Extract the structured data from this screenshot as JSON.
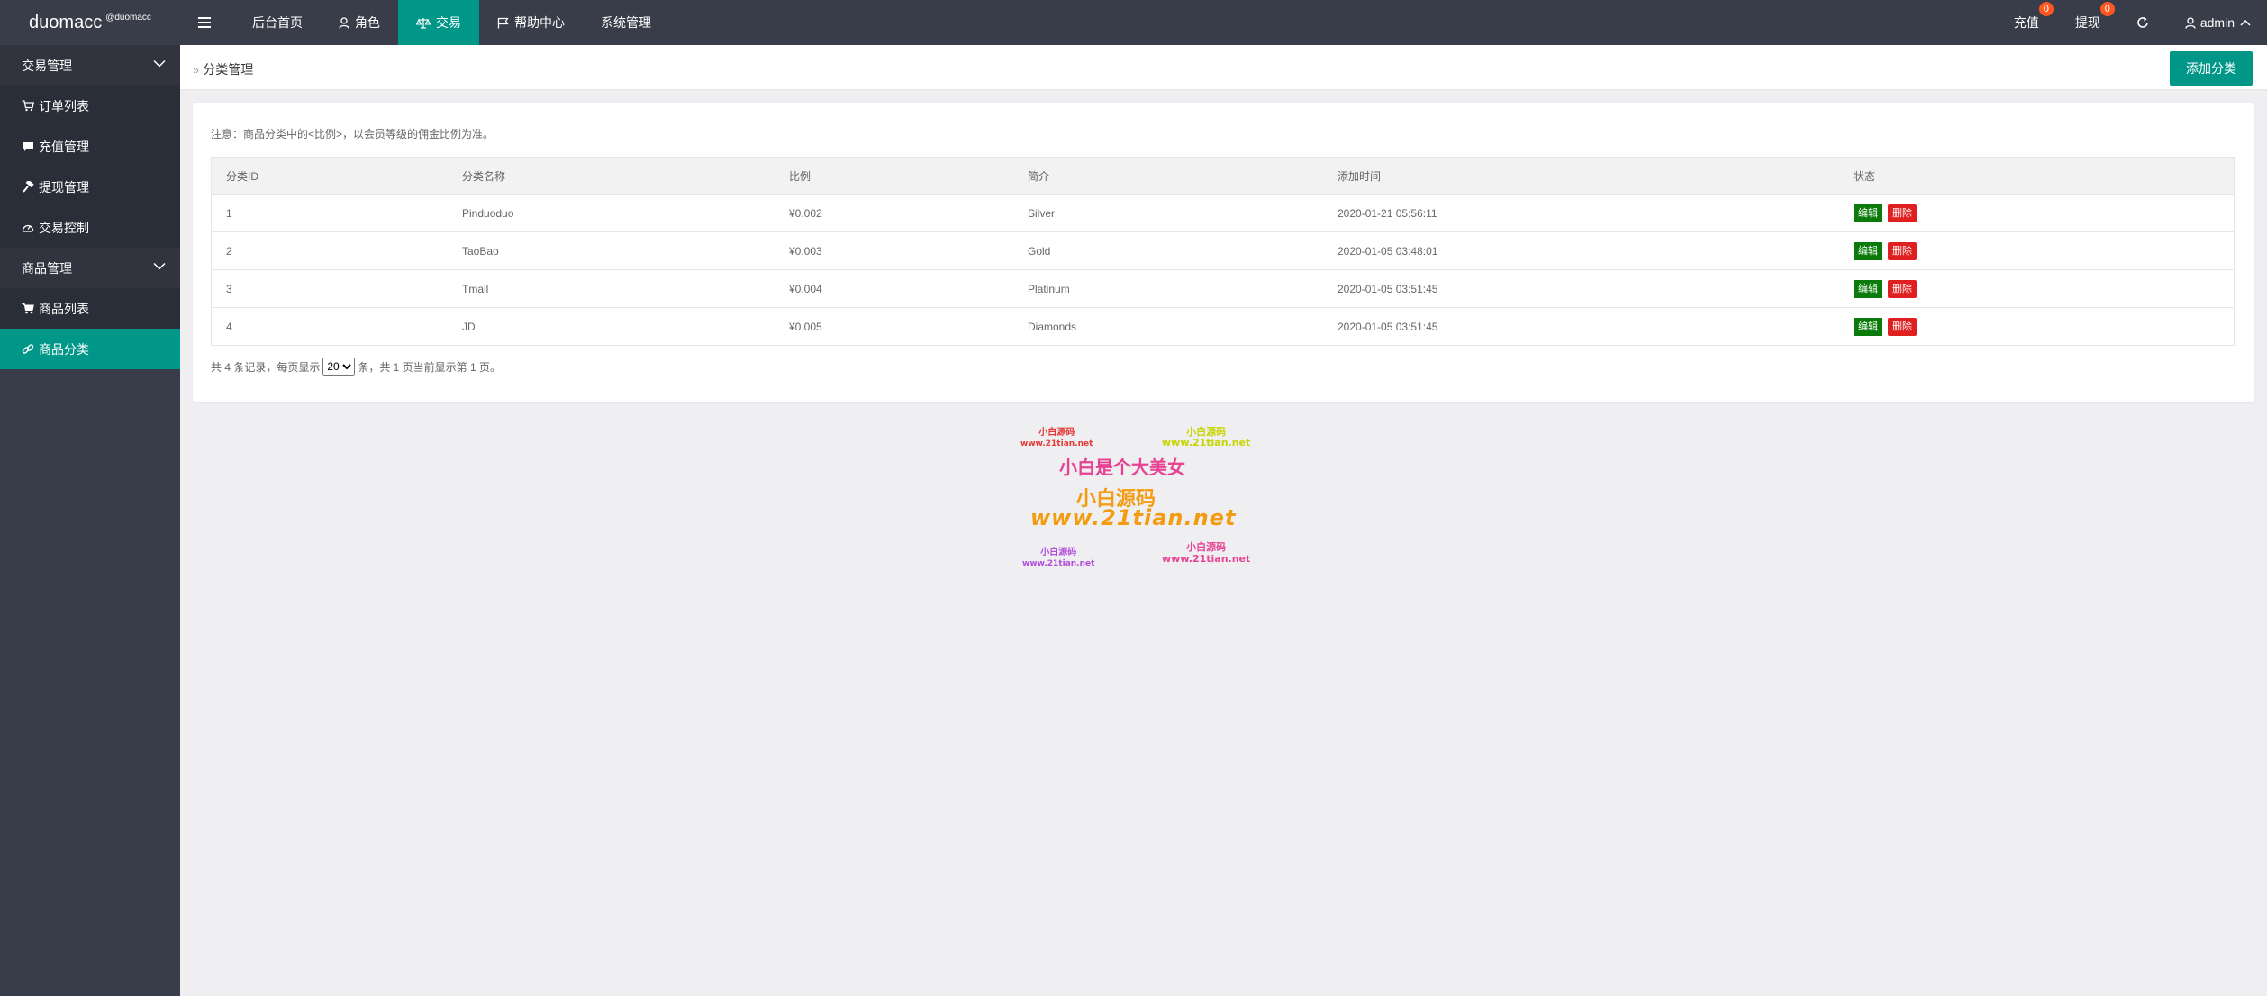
{
  "brand": {
    "name": "duomacc",
    "sub": "@duomacc"
  },
  "nav": {
    "menu_icon": "hamburger-icon",
    "items": [
      {
        "label": "后台首页",
        "icon": ""
      },
      {
        "label": "角色",
        "icon": "user-icon"
      },
      {
        "label": "交易",
        "icon": "scale-icon",
        "active": true
      },
      {
        "label": "帮助中心",
        "icon": "flag-icon"
      },
      {
        "label": "系统管理",
        "icon": ""
      }
    ]
  },
  "topright": {
    "recharge": {
      "label": "充值",
      "badge": "0"
    },
    "withdraw": {
      "label": "提现",
      "badge": "0"
    },
    "refresh_icon": "refresh-icon",
    "user": "admin"
  },
  "sidebar": {
    "group1": "交易管理",
    "items1": [
      "订单列表",
      "充值管理",
      "提现管理",
      "交易控制"
    ],
    "group2": "商品管理",
    "items2": [
      "商品列表",
      "商品分类"
    ]
  },
  "breadcrumb": "分类管理",
  "add_button": "添加分类",
  "note": "注意：商品分类中的<比例>，以会员等级的佣金比例为准。",
  "table": {
    "headers": [
      "分类ID",
      "分类名称",
      "比例",
      "简介",
      "添加时间",
      "状态"
    ],
    "rows": [
      {
        "id": "1",
        "name": "Pinduoduo",
        "ratio": "¥0.002",
        "desc": "Silver",
        "time": "2020-01-21 05:56:11"
      },
      {
        "id": "2",
        "name": "TaoBao",
        "ratio": "¥0.003",
        "desc": "Gold",
        "time": "2020-01-05 03:48:01"
      },
      {
        "id": "3",
        "name": "Tmall",
        "ratio": "¥0.004",
        "desc": "Platinum",
        "time": "2020-01-05 03:51:45"
      },
      {
        "id": "4",
        "name": "JD",
        "ratio": "¥0.005",
        "desc": "Diamonds",
        "time": "2020-01-05 03:51:45"
      }
    ],
    "edit_label": "编辑",
    "delete_label": "删除"
  },
  "pager": {
    "before": "共 4 条记录，每页显示",
    "selected": "20",
    "after": "条，共 1 页当前显示第 1 页。"
  },
  "watermark": {
    "l1a": "小白源码",
    "l1b": "www.21tian.net",
    "l1c": "小白源码",
    "l1d": "www.21tian.net",
    "main": "小白是个大美女",
    "big1": "小白源码",
    "big2": "www.21tian.net",
    "l3a": "小白源码",
    "l3b": "www.21tian.net",
    "l3c": "小白源码",
    "l3d": "www.21tian.net"
  },
  "colors": {
    "accent": "#009688",
    "dark": "#393d49",
    "edit": "#0a7a0a",
    "delete": "#e02020"
  }
}
